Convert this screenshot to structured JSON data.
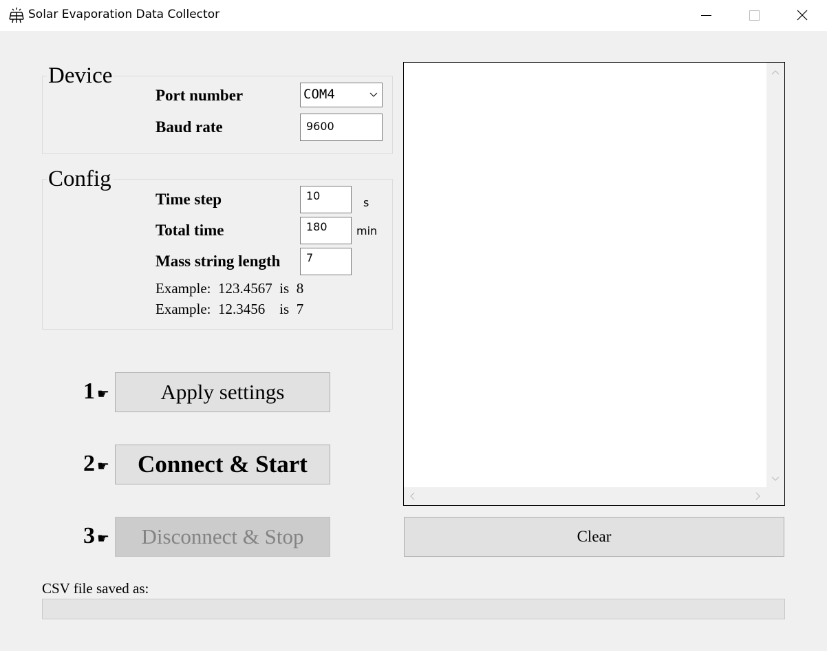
{
  "window": {
    "title": "Solar Evaporation Data Collector"
  },
  "device": {
    "legend": "Device",
    "port_label": "Port number",
    "port_value": "COM4",
    "baud_label": "Baud rate",
    "baud_value": "9600"
  },
  "config": {
    "legend": "Config",
    "time_step_label": "Time step",
    "time_step_value": "10",
    "time_step_unit": "s",
    "total_time_label": "Total time",
    "total_time_value": "180",
    "total_time_unit": "min",
    "mass_len_label": "Mass string length",
    "mass_len_value": "7",
    "example1": "Example:  123.4567  is  8",
    "example2": "Example:  12.3456    is  7"
  },
  "steps": [
    {
      "number": "1",
      "hand": "☛",
      "label": "Apply settings",
      "enabled": true
    },
    {
      "number": "2",
      "hand": "☛",
      "label": "Connect & Start",
      "enabled": true
    },
    {
      "number": "3",
      "hand": "☛",
      "label": "Disconnect & Stop",
      "enabled": false
    }
  ],
  "log": {
    "text": "",
    "clear_label": "Clear"
  },
  "csv": {
    "label": "CSV file saved as:",
    "value": ""
  },
  "colors": {
    "background": "#f0f0f0",
    "button": "#e1e1e1",
    "button_disabled": "#cccccc",
    "text_disabled": "#838383"
  },
  "icons": {
    "app": "solar-panel-icon",
    "minimize": "minimize-icon",
    "maximize": "maximize-icon",
    "close": "close-icon"
  }
}
